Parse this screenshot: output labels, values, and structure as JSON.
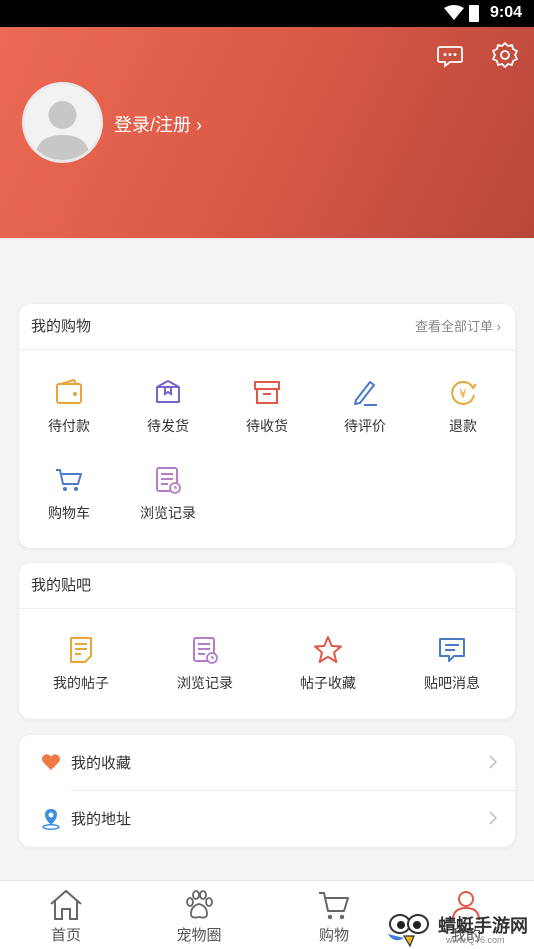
{
  "status_bar": {
    "time": "9:04"
  },
  "profile": {
    "login_label": "登录/注册 ›"
  },
  "shopping": {
    "title": "我的购物",
    "view_all": "查看全部订单 ›",
    "items": [
      {
        "label": "待付款",
        "icon": "wallet-icon"
      },
      {
        "label": "待发货",
        "icon": "package-icon"
      },
      {
        "label": "待收货",
        "icon": "box-icon"
      },
      {
        "label": "待评价",
        "icon": "pencil-icon"
      },
      {
        "label": "退款",
        "icon": "yen-refund-icon"
      },
      {
        "label": "购物车",
        "icon": "cart-icon"
      },
      {
        "label": "浏览记录",
        "icon": "history-icon"
      }
    ]
  },
  "tieba": {
    "title": "我的贴吧",
    "items": [
      {
        "label": "我的帖子",
        "icon": "post-icon"
      },
      {
        "label": "浏览记录",
        "icon": "history-icon"
      },
      {
        "label": "帖子收藏",
        "icon": "star-icon"
      },
      {
        "label": "贴吧消息",
        "icon": "message-icon"
      }
    ]
  },
  "list": {
    "items": [
      {
        "label": "我的收藏",
        "icon": "heart-icon"
      },
      {
        "label": "我的地址",
        "icon": "location-icon"
      }
    ]
  },
  "tabbar": {
    "items": [
      {
        "label": "首页",
        "icon": "home-icon"
      },
      {
        "label": "宠物圈",
        "icon": "paw-icon"
      },
      {
        "label": "购物",
        "icon": "cart-icon"
      },
      {
        "label": "我的",
        "icon": "user-icon"
      }
    ]
  },
  "watermark": {
    "text": "蜻蜓手游网",
    "url": "www.QT6.com"
  },
  "colors": {
    "header_start": "#ec6a55",
    "header_end": "#b8473a",
    "orange": "#e8a53a",
    "purple": "#7b62c9",
    "red": "#e0584a",
    "blue": "#4a7ac8",
    "violet": "#b77cc9"
  }
}
